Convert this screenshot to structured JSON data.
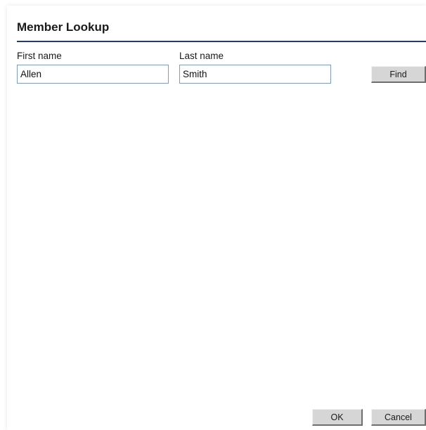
{
  "dialog": {
    "title": "Member Lookup"
  },
  "form": {
    "first_name_label": "First name",
    "first_name_value": "Allen",
    "last_name_label": "Last name",
    "last_name_value": "Smith",
    "find_label": "Find"
  },
  "footer": {
    "ok_label": "OK",
    "cancel_label": "Cancel"
  },
  "colors": {
    "title_rule": "#1f3f66",
    "input_border": "#7f9db9",
    "button_face": "#d6d6d6"
  }
}
